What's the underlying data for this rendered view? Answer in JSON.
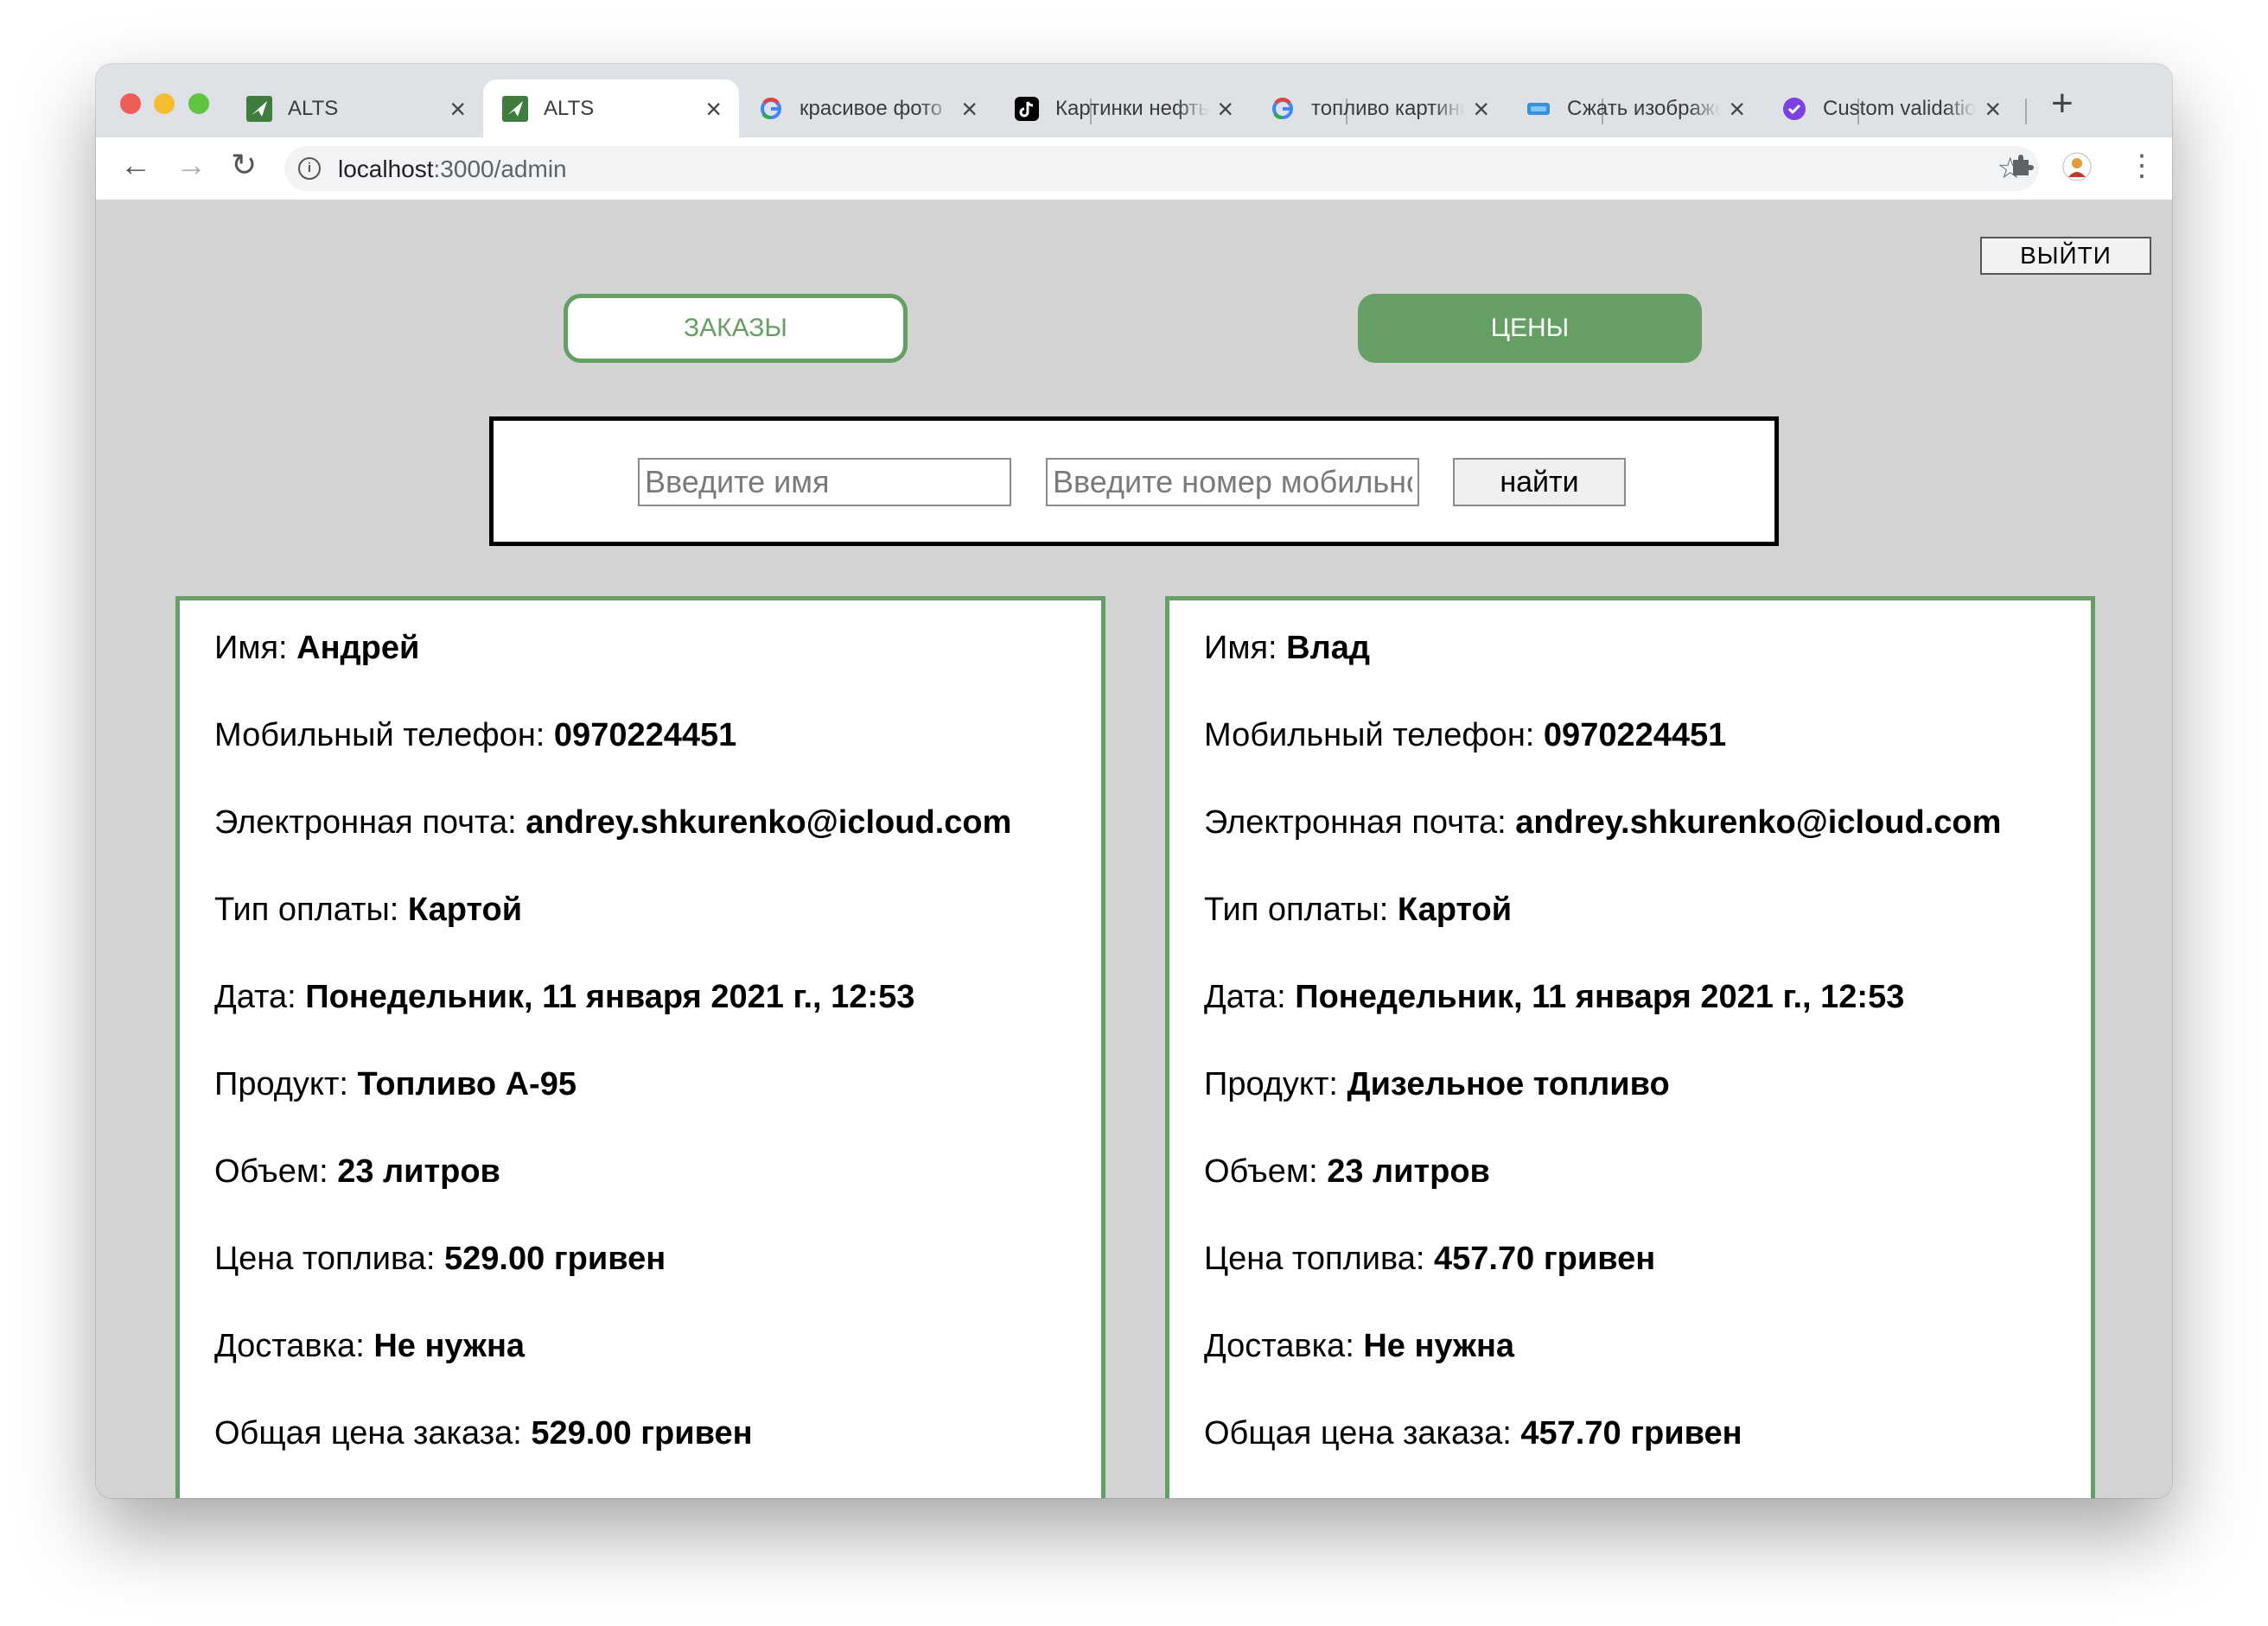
{
  "browser": {
    "tabs": [
      {
        "title": "ALTS",
        "icon": "alts-logo-icon",
        "active": false
      },
      {
        "title": "ALTS",
        "icon": "alts-logo-icon",
        "active": true
      },
      {
        "title": "красивое фото",
        "icon": "google-icon",
        "active": false
      },
      {
        "title": "Картинки нефть",
        "icon": "tiktok-icon",
        "active": false
      },
      {
        "title": "топливо картинки",
        "icon": "google-icon",
        "active": false
      },
      {
        "title": "Сжать изображение",
        "icon": "compress-icon",
        "active": false
      },
      {
        "title": "Custom validation",
        "icon": "check-badge-icon",
        "active": false
      }
    ],
    "url_host": "localhost",
    "url_path": ":3000/admin"
  },
  "header": {
    "logout_label": "ВЫЙТИ",
    "orders_label": "ЗАКАЗЫ",
    "prices_label": "ЦЕНЫ"
  },
  "search": {
    "name_placeholder": "Введите имя",
    "phone_placeholder": "Введите номер мобильного",
    "find_label": "найти"
  },
  "orders": [
    {
      "rows": [
        {
          "label": "Имя: ",
          "value": "Андрей"
        },
        {
          "label": "Мобильный телефон: ",
          "value": "0970224451"
        },
        {
          "label": "Электронная почта: ",
          "value": "andrey.shkurenko@icloud.com"
        },
        {
          "label": "Тип оплаты: ",
          "value": "Картой"
        },
        {
          "label": "Дата: ",
          "value": "Понедельник, 11 января 2021 г., 12:53"
        },
        {
          "label": "Продукт: ",
          "value": "Топливо А-95"
        },
        {
          "label": "Объем: ",
          "value": "23 литров"
        },
        {
          "label": "Цена топлива: ",
          "value": "529.00 гривен"
        },
        {
          "label": "Доставка: ",
          "value": "Не нужна"
        },
        {
          "label": "Общая цена заказа: ",
          "value": "529.00 гривен"
        }
      ]
    },
    {
      "rows": [
        {
          "label": "Имя: ",
          "value": "Влад"
        },
        {
          "label": "Мобильный телефон: ",
          "value": "0970224451"
        },
        {
          "label": "Электронная почта: ",
          "value": "andrey.shkurenko@icloud.com"
        },
        {
          "label": "Тип оплаты: ",
          "value": "Картой"
        },
        {
          "label": "Дата: ",
          "value": "Понедельник, 11 января 2021 г., 12:53"
        },
        {
          "label": "Продукт: ",
          "value": "Дизельное топливо"
        },
        {
          "label": "Объем: ",
          "value": "23 литров"
        },
        {
          "label": "Цена топлива: ",
          "value": "457.70 гривен"
        },
        {
          "label": "Доставка: ",
          "value": "Не нужна"
        },
        {
          "label": "Общая цена заказа: ",
          "value": "457.70 гривен"
        }
      ]
    }
  ],
  "colors": {
    "accent_green": "#669f63",
    "page_background": "#d3d3d3"
  }
}
